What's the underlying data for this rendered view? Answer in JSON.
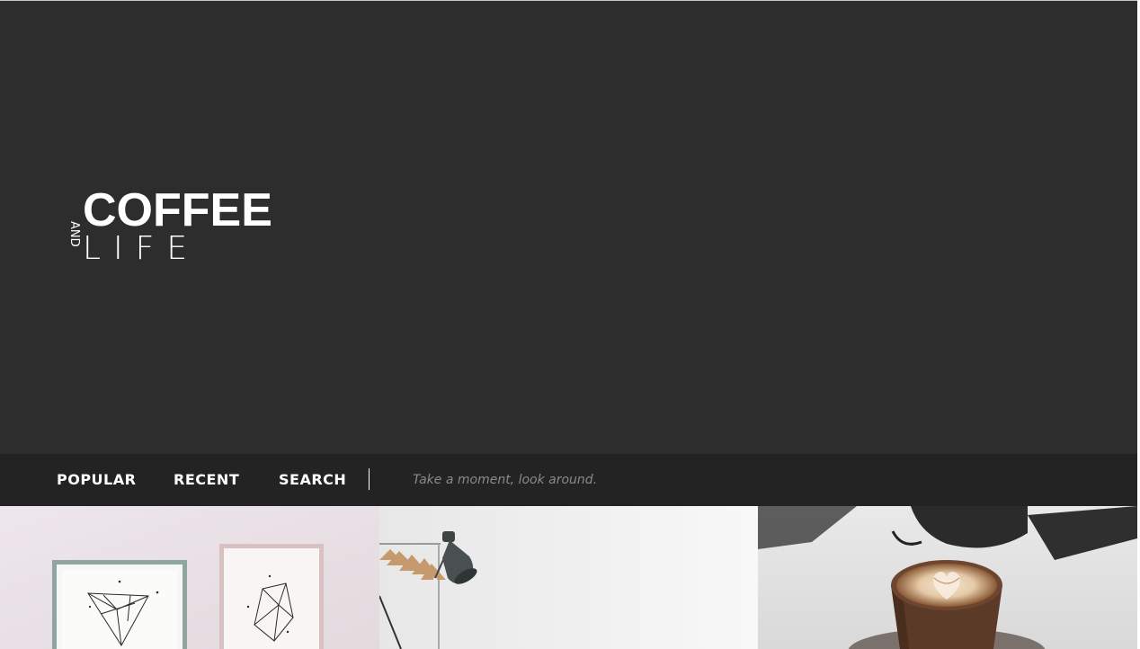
{
  "brand": {
    "line1": "COFFEE",
    "connector": "AND",
    "line2": "LIFE"
  },
  "nav": {
    "items": [
      {
        "label": "POPULAR"
      },
      {
        "label": "RECENT"
      },
      {
        "label": "SEARCH"
      }
    ],
    "search_placeholder": "Take a moment, look around.",
    "search_value": ""
  },
  "gallery": {
    "tiles": [
      {
        "subject": "framed geometric art prints on a pink wall"
      },
      {
        "subject": "desk lamp and clothes rack with hangers"
      },
      {
        "subject": "latte art in a glass cup with glasses and jug"
      }
    ]
  },
  "colors": {
    "hero_bg": "#2d2d2d",
    "nav_bg": "#232323",
    "text": "#ffffff",
    "placeholder": "#8a8a8a"
  }
}
